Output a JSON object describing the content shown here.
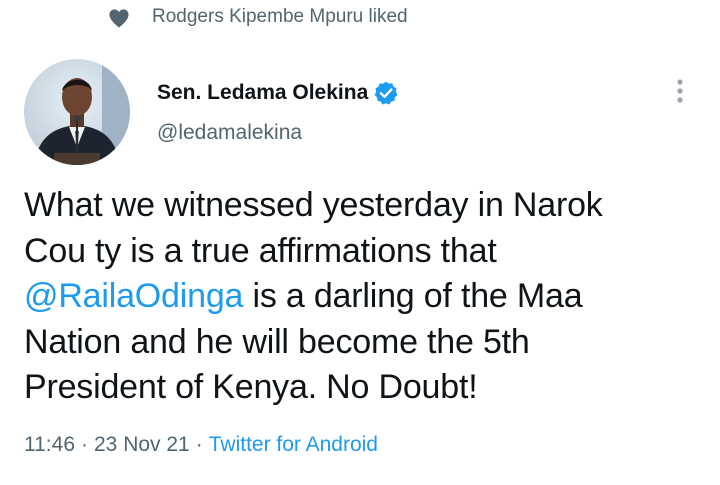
{
  "social_context": {
    "icon": "heart-icon",
    "text": "Rodgers Kipembe Mpuru liked"
  },
  "author": {
    "name": "Sen. Ledama Olekina",
    "handle": "@ledamalekina",
    "verified": true
  },
  "tweet": {
    "text_before_mention_line1": "What we witnessed yesterday in Narok",
    "line2": "Cou ty is a true affirmations that",
    "mention": "@RailaOdinga",
    "after_mention": " is a darling of the Maa",
    "line4": "Nation and he will become the 5th",
    "line5": "President of Kenya. No Doubt!"
  },
  "meta": {
    "time": "11:46",
    "separator": "·",
    "date": "23 Nov 21",
    "source": "Twitter for Android"
  },
  "colors": {
    "accent": "#1d9bf0",
    "secondary_text": "#536471",
    "primary_text": "#0f1419"
  }
}
